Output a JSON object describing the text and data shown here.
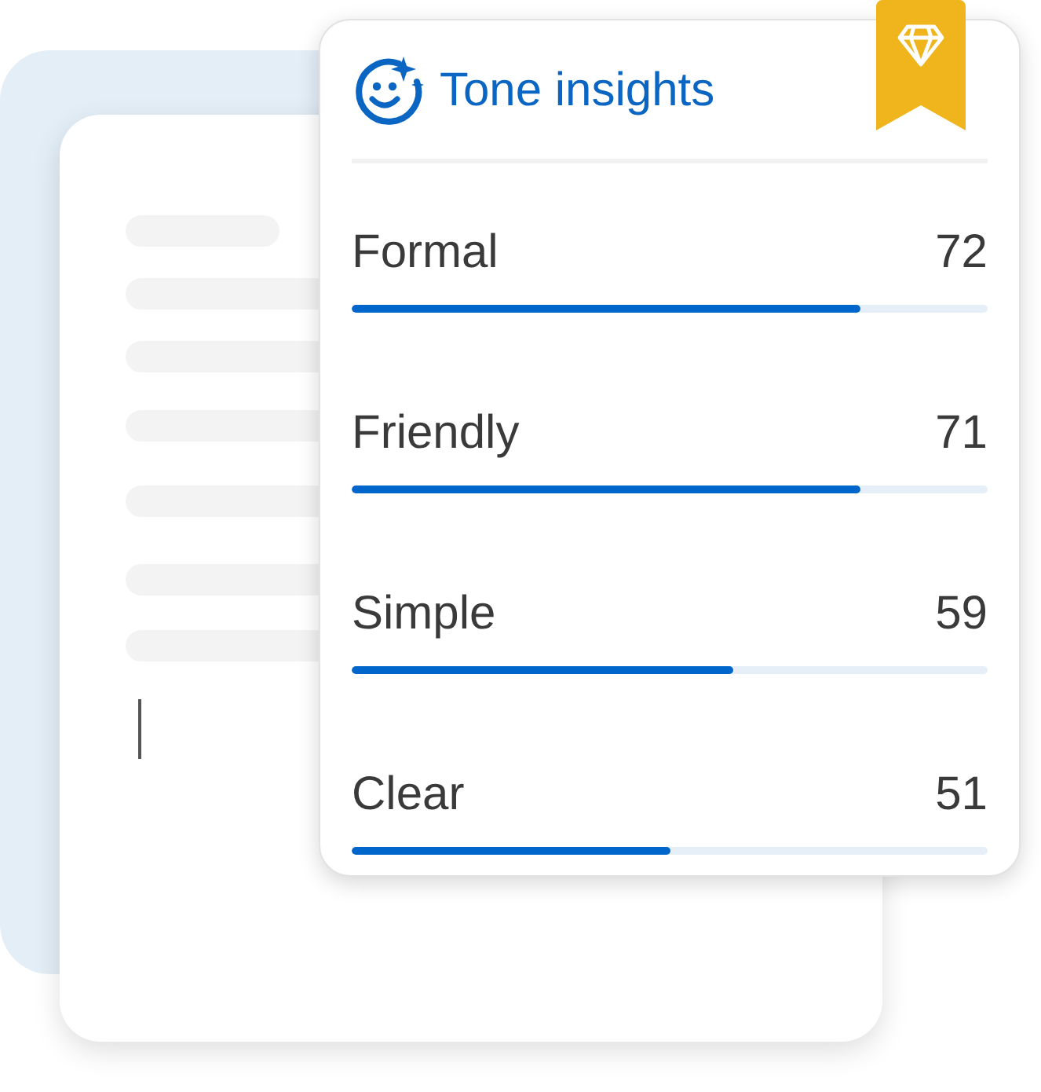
{
  "panel": {
    "title": "Tone insights"
  },
  "tones": [
    {
      "label": "Formal",
      "value": "72",
      "level": 0.8
    },
    {
      "label": "Friendly",
      "value": "71",
      "level": 0.8
    },
    {
      "label": "Simple",
      "value": "59",
      "level": 0.6
    },
    {
      "label": "Clear",
      "value": "51",
      "level": 0.5
    }
  ]
}
